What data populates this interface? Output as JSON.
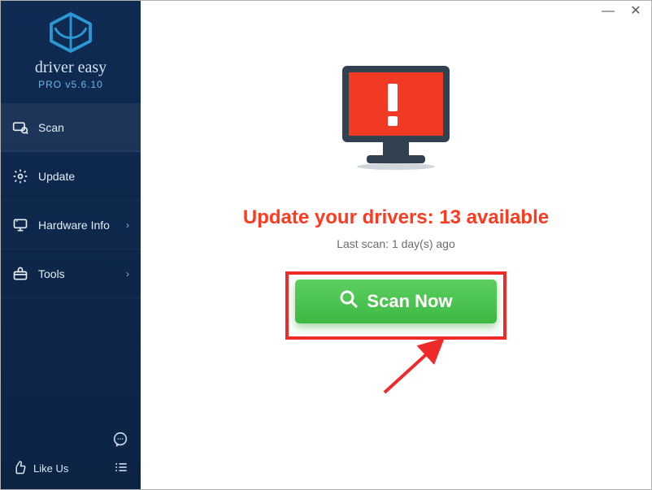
{
  "brand": {
    "name": "driver easy",
    "tag": "PRO v5.6.10",
    "accent": "#2a98d4"
  },
  "sidebar": {
    "items": [
      {
        "label": "Scan",
        "icon": "scan-icon",
        "chevron": false,
        "active": true
      },
      {
        "label": "Update",
        "icon": "gear-icon",
        "chevron": false,
        "active": false
      },
      {
        "label": "Hardware Info",
        "icon": "monitor-icon",
        "chevron": true,
        "active": false
      },
      {
        "label": "Tools",
        "icon": "toolbox-icon",
        "chevron": true,
        "active": false
      }
    ],
    "like_label": "Like Us"
  },
  "titlebar": {
    "minimize": "—",
    "close": "✕"
  },
  "content": {
    "headline_prefix": "Update your drivers: ",
    "count": "13",
    "headline_suffix": " available",
    "subline": "Last scan: 1 day(s) ago",
    "scan_label": "Scan Now"
  },
  "colors": {
    "alert": "#ff3a1f",
    "button": "#3db843",
    "highlight_box": "#ef2a2a"
  }
}
